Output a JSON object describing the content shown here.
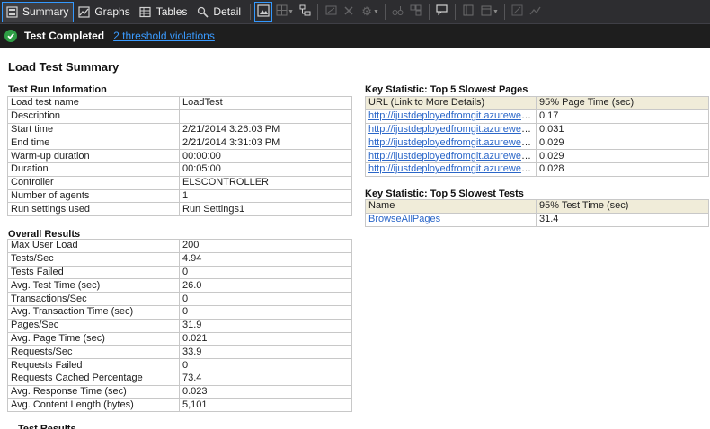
{
  "toolbar": {
    "tabs": [
      {
        "label": "Summary",
        "icon": "summary-icon",
        "active": true
      },
      {
        "label": "Graphs",
        "icon": "graphs-icon",
        "active": false
      },
      {
        "label": "Tables",
        "icon": "tables-icon",
        "active": false
      },
      {
        "label": "Detail",
        "icon": "detail-icon",
        "active": false
      }
    ]
  },
  "status": {
    "text": "Test Completed",
    "link": "2 threshold violations",
    "color": "#2f9e45"
  },
  "report": {
    "title": "Load Test Summary",
    "test_run": {
      "title": "Test Run Information",
      "rows": [
        [
          "Load test name",
          "LoadTest"
        ],
        [
          "Description",
          ""
        ],
        [
          "Start time",
          "2/21/2014 3:26:03 PM"
        ],
        [
          "End time",
          "2/21/2014 3:31:03 PM"
        ],
        [
          "Warm-up duration",
          "00:00:00"
        ],
        [
          "Duration",
          "00:05:00"
        ],
        [
          "Controller",
          "ELSCONTROLLER"
        ],
        [
          "Number of agents",
          "1"
        ],
        [
          "Run settings used",
          "Run Settings1"
        ]
      ]
    },
    "overall": {
      "title": "Overall Results",
      "rows": [
        [
          "Max User Load",
          "200"
        ],
        [
          "Tests/Sec",
          "4.94"
        ],
        [
          "Tests Failed",
          "0"
        ],
        [
          "Avg. Test Time (sec)",
          "26.0"
        ],
        [
          "Transactions/Sec",
          "0"
        ],
        [
          "Avg. Transaction Time (sec)",
          "0"
        ],
        [
          "Pages/Sec",
          "31.9"
        ],
        [
          "Avg. Page Time (sec)",
          "0.021"
        ],
        [
          "Requests/Sec",
          "33.9"
        ],
        [
          "Requests Failed",
          "0"
        ],
        [
          "Requests Cached Percentage",
          "73.4"
        ],
        [
          "Avg. Response Time (sec)",
          "0.023"
        ],
        [
          "Avg. Content Length (bytes)",
          "5,101"
        ]
      ]
    },
    "slowest_pages": {
      "title": "Key Statistic: Top 5 Slowest Pages",
      "headers": [
        "URL (Link to More Details)",
        "95% Page Time (sec)"
      ],
      "rows": [
        [
          "http://ijustdeployedfromgit.azurewebsite...",
          "0.17"
        ],
        [
          "http://ijustdeployedfromgit.azurewebsite...",
          "0.031"
        ],
        [
          "http://ijustdeployedfromgit.azurewebsite...",
          "0.029"
        ],
        [
          "http://ijustdeployedfromgit.azurewebsite...",
          "0.029"
        ],
        [
          "http://ijustdeployedfromgit.azurewebsite...",
          "0.028"
        ]
      ]
    },
    "slowest_tests": {
      "title": "Key Statistic: Top 5 Slowest Tests",
      "headers": [
        "Name",
        "95% Test Time (sec)"
      ],
      "rows": [
        [
          "BrowseAllPages",
          "31.4"
        ]
      ]
    },
    "next_section_title": "Test Results"
  }
}
